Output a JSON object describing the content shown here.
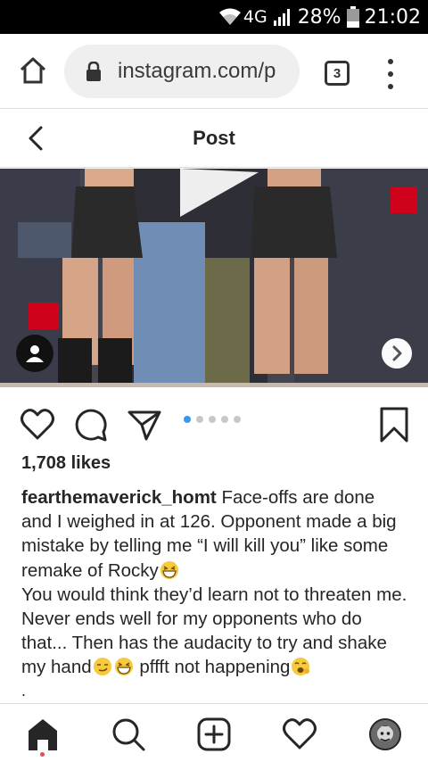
{
  "status_bar": {
    "network": "4G",
    "battery": "28%",
    "time": "21:02"
  },
  "browser": {
    "url": "instagram.com/p",
    "tab_count": "3"
  },
  "post_header": {
    "title": "Post"
  },
  "media": {
    "carousel_total": 5,
    "carousel_active_index": 0
  },
  "likes": "1,708 likes",
  "caption": {
    "username": "fearthemaverick_homt",
    "text_1": " Face-offs are done and I weighed in at 126. Opponent made a big mistake by telling me “I will kill you” like some remake of Rocky",
    "text_2": "You would think they’d learn not to threaten me. Never ends well for my opponents who do that... Then has the audacity to try and shake my hand",
    "text_3": " pffft not happening",
    "trailing": "."
  },
  "colors": {
    "accent": "#3897f0",
    "notification": "#ed4956",
    "text": "#262626"
  },
  "bottom_nav": {
    "items": [
      "home-icon",
      "search-icon",
      "new-post-icon",
      "activity-heart-icon",
      "profile-avatar"
    ]
  }
}
